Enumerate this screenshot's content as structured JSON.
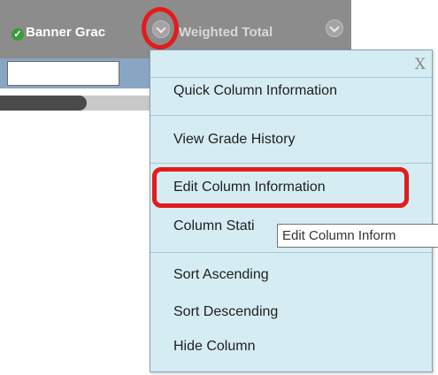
{
  "grid_header": {
    "columns": [
      {
        "label": "Banner Grac",
        "checked": true
      },
      {
        "label": "Weighted Total"
      }
    ],
    "grade_input_value": ""
  },
  "context_menu": {
    "close_label": "X",
    "items": [
      {
        "label": "Quick Column Information"
      },
      {
        "label": "View Grade History"
      },
      {
        "label": "Edit Column Information",
        "highlighted": true
      },
      {
        "label": "Column Stati"
      },
      {
        "label": "Sort Ascending"
      },
      {
        "label": "Sort Descending"
      },
      {
        "label": "Hide Column"
      }
    ]
  },
  "tooltip": {
    "text": "Edit Column Inform"
  },
  "colors": {
    "header_gray": "#8c8c8c",
    "menu_background": "#d6ecf3",
    "highlight_red": "#e21c1c",
    "check_green": "#3a9d3a"
  },
  "icons": {
    "column_menu_chevron": "chevron-down-icon",
    "checked": "check-icon"
  }
}
